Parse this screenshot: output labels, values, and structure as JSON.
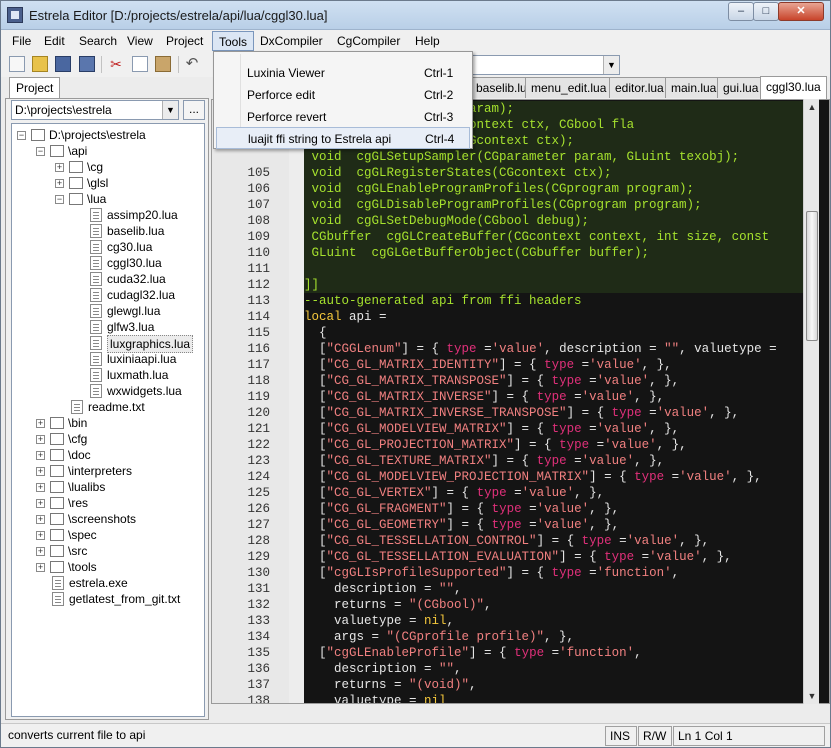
{
  "window": {
    "title": "Estrela Editor [D:/projects/estrela/api/lua/cggl30.lua]",
    "controls": {
      "minimize": "–",
      "maximize": "□",
      "close": "✕"
    }
  },
  "menu": [
    "File",
    "Edit",
    "Search",
    "View",
    "Project",
    "Tools",
    "DxCompiler",
    "CgCompiler",
    "Help"
  ],
  "tools_menu": [
    {
      "label": "Luxinia Viewer",
      "shortcut": "Ctrl-1"
    },
    {
      "label": "Perforce edit",
      "shortcut": "Ctrl-2"
    },
    {
      "label": "Perforce revert",
      "shortcut": "Ctrl-3"
    },
    {
      "label": "luajit ffi string to Estrela api",
      "shortcut": "Ctrl-4"
    }
  ],
  "project": {
    "tab": "Project",
    "path": "D:\\projects\\estrela",
    "browse": "...",
    "tree": [
      {
        "label": "D:\\projects\\estrela",
        "level": 0,
        "type": "folder",
        "expander": "−"
      },
      {
        "label": "\\api",
        "level": 1,
        "type": "folder",
        "expander": "−"
      },
      {
        "label": "\\cg",
        "level": 2,
        "type": "folder",
        "expander": "+"
      },
      {
        "label": "\\glsl",
        "level": 2,
        "type": "folder",
        "expander": "+"
      },
      {
        "label": "\\lua",
        "level": 2,
        "type": "folder",
        "expander": "−"
      },
      {
        "label": "assimp20.lua",
        "level": 3,
        "type": "file"
      },
      {
        "label": "baselib.lua",
        "level": 3,
        "type": "file"
      },
      {
        "label": "cg30.lua",
        "level": 3,
        "type": "file"
      },
      {
        "label": "cggl30.lua",
        "level": 3,
        "type": "file"
      },
      {
        "label": "cuda32.lua",
        "level": 3,
        "type": "file"
      },
      {
        "label": "cudagl32.lua",
        "level": 3,
        "type": "file"
      },
      {
        "label": "glewgl.lua",
        "level": 3,
        "type": "file"
      },
      {
        "label": "glfw3.lua",
        "level": 3,
        "type": "file"
      },
      {
        "label": "luxgraphics.lua",
        "level": 3,
        "type": "file",
        "selected": true
      },
      {
        "label": "luxiniaapi.lua",
        "level": 3,
        "type": "file"
      },
      {
        "label": "luxmath.lua",
        "level": 3,
        "type": "file"
      },
      {
        "label": "wxwidgets.lua",
        "level": 3,
        "type": "file"
      },
      {
        "label": "readme.txt",
        "level": 2,
        "type": "file"
      },
      {
        "label": "\\bin",
        "level": 1,
        "type": "folder",
        "expander": "+"
      },
      {
        "label": "\\cfg",
        "level": 1,
        "type": "folder",
        "expander": "+"
      },
      {
        "label": "\\doc",
        "level": 1,
        "type": "folder",
        "expander": "+"
      },
      {
        "label": "\\interpreters",
        "level": 1,
        "type": "folder",
        "expander": "+"
      },
      {
        "label": "\\lualibs",
        "level": 1,
        "type": "folder",
        "expander": "+"
      },
      {
        "label": "\\res",
        "level": 1,
        "type": "folder",
        "expander": "+"
      },
      {
        "label": "\\screenshots",
        "level": 1,
        "type": "folder",
        "expander": "+"
      },
      {
        "label": "\\spec",
        "level": 1,
        "type": "folder",
        "expander": "+"
      },
      {
        "label": "\\src",
        "level": 1,
        "type": "folder",
        "expander": "+"
      },
      {
        "label": "\\tools",
        "level": 1,
        "type": "folder",
        "expander": "+"
      },
      {
        "label": "estrela.exe",
        "level": 1,
        "type": "file"
      },
      {
        "label": "getlatest_from_git.txt",
        "level": 1,
        "type": "file"
      }
    ]
  },
  "file_tabs": [
    {
      "label": "baselib.lua",
      "active": false
    },
    {
      "label": "menu_edit.lua",
      "active": false
    },
    {
      "label": "editor.lua",
      "active": false
    },
    {
      "label": "main.lua",
      "active": false
    },
    {
      "label": "gui.lua",
      "active": false
    },
    {
      "label": "cggl30.lua",
      "active": true
    }
  ],
  "editor": {
    "lines": [
      {
        "no": "",
        "green": true,
        "segs": [
          [
            "  ",
            "n"
          ],
          [
            "reEnum(CGparameter param);",
            "cm"
          ]
        ]
      },
      {
        "no": "",
        "green": true,
        "segs": [
          [
            "  ",
            "n"
          ],
          [
            "extureParameters(CGcontext ctx, CGbool fla",
            "cm"
          ]
        ]
      },
      {
        "no": "",
        "green": true,
        "segs": [
          [
            "  ",
            "n"
          ],
          [
            "eTextureParameters(CGcontext ctx);",
            "cm"
          ]
        ]
      },
      {
        "no": "",
        "green": true,
        "segs": [
          [
            " void  cgGLSetupSampler(CGparameter param, GLuint texobj);",
            "cm"
          ]
        ]
      },
      {
        "no": "105",
        "green": true,
        "segs": [
          [
            " void  cgGLRegisterStates(CGcontext ctx);",
            "cm"
          ]
        ]
      },
      {
        "no": "106",
        "green": true,
        "segs": [
          [
            " void  cgGLEnableProgramProfiles(CGprogram program);",
            "cm"
          ]
        ]
      },
      {
        "no": "107",
        "green": true,
        "segs": [
          [
            " void  cgGLDisableProgramProfiles(CGprogram program);",
            "cm"
          ]
        ]
      },
      {
        "no": "108",
        "green": true,
        "segs": [
          [
            " void  cgGLSetDebugMode(CGbool debug);",
            "cm"
          ]
        ]
      },
      {
        "no": "109",
        "green": true,
        "segs": [
          [
            " CGbuffer  cgGLCreateBuffer(CGcontext context, int size, const",
            "cm"
          ]
        ]
      },
      {
        "no": "110",
        "green": true,
        "segs": [
          [
            " GLuint  cgGLGetBufferObject(CGbuffer buffer);",
            "cm"
          ]
        ]
      },
      {
        "no": "111",
        "green": true,
        "segs": [
          [
            "",
            "cm"
          ]
        ]
      },
      {
        "no": "112",
        "green": true,
        "segs": [
          [
            "]]",
            "cm"
          ]
        ]
      },
      {
        "no": "113",
        "green": false,
        "segs": [
          [
            "--auto-generated api from ffi headers",
            "cm"
          ]
        ]
      },
      {
        "no": "114",
        "green": false,
        "segs": [
          [
            "local",
            "kw"
          ],
          [
            " api =",
            "n"
          ]
        ]
      },
      {
        "no": "115",
        "green": false,
        "segs": [
          [
            "  {",
            "n"
          ]
        ]
      },
      {
        "no": "116",
        "green": false,
        "segs": [
          [
            "  [",
            "n"
          ],
          [
            "\"CGGLenum\"",
            "str"
          ],
          [
            "] = { ",
            "n"
          ],
          [
            "type",
            "ty"
          ],
          [
            " =",
            "n"
          ],
          [
            "'value'",
            "str"
          ],
          [
            ", description = ",
            "n"
          ],
          [
            "\"\"",
            "str"
          ],
          [
            ", valuetype =",
            "n"
          ]
        ]
      },
      {
        "no": "117",
        "green": false,
        "segs": [
          [
            "  [",
            "n"
          ],
          [
            "\"CG_GL_MATRIX_IDENTITY\"",
            "str"
          ],
          [
            "] = { ",
            "n"
          ],
          [
            "type",
            "ty"
          ],
          [
            " =",
            "n"
          ],
          [
            "'value'",
            "str"
          ],
          [
            ", },",
            "n"
          ]
        ]
      },
      {
        "no": "118",
        "green": false,
        "segs": [
          [
            "  [",
            "n"
          ],
          [
            "\"CG_GL_MATRIX_TRANSPOSE\"",
            "str"
          ],
          [
            "] = { ",
            "n"
          ],
          [
            "type",
            "ty"
          ],
          [
            " =",
            "n"
          ],
          [
            "'value'",
            "str"
          ],
          [
            ", },",
            "n"
          ]
        ]
      },
      {
        "no": "119",
        "green": false,
        "segs": [
          [
            "  [",
            "n"
          ],
          [
            "\"CG_GL_MATRIX_INVERSE\"",
            "str"
          ],
          [
            "] = { ",
            "n"
          ],
          [
            "type",
            "ty"
          ],
          [
            " =",
            "n"
          ],
          [
            "'value'",
            "str"
          ],
          [
            ", },",
            "n"
          ]
        ]
      },
      {
        "no": "120",
        "green": false,
        "segs": [
          [
            "  [",
            "n"
          ],
          [
            "\"CG_GL_MATRIX_INVERSE_TRANSPOSE\"",
            "str"
          ],
          [
            "] = { ",
            "n"
          ],
          [
            "type",
            "ty"
          ],
          [
            " =",
            "n"
          ],
          [
            "'value'",
            "str"
          ],
          [
            ", },",
            "n"
          ]
        ]
      },
      {
        "no": "121",
        "green": false,
        "segs": [
          [
            "  [",
            "n"
          ],
          [
            "\"CG_GL_MODELVIEW_MATRIX\"",
            "str"
          ],
          [
            "] = { ",
            "n"
          ],
          [
            "type",
            "ty"
          ],
          [
            " =",
            "n"
          ],
          [
            "'value'",
            "str"
          ],
          [
            ", },",
            "n"
          ]
        ]
      },
      {
        "no": "122",
        "green": false,
        "segs": [
          [
            "  [",
            "n"
          ],
          [
            "\"CG_GL_PROJECTION_MATRIX\"",
            "str"
          ],
          [
            "] = { ",
            "n"
          ],
          [
            "type",
            "ty"
          ],
          [
            " =",
            "n"
          ],
          [
            "'value'",
            "str"
          ],
          [
            ", },",
            "n"
          ]
        ]
      },
      {
        "no": "123",
        "green": false,
        "segs": [
          [
            "  [",
            "n"
          ],
          [
            "\"CG_GL_TEXTURE_MATRIX\"",
            "str"
          ],
          [
            "] = { ",
            "n"
          ],
          [
            "type",
            "ty"
          ],
          [
            " =",
            "n"
          ],
          [
            "'value'",
            "str"
          ],
          [
            ", },",
            "n"
          ]
        ]
      },
      {
        "no": "124",
        "green": false,
        "segs": [
          [
            "  [",
            "n"
          ],
          [
            "\"CG_GL_MODELVIEW_PROJECTION_MATRIX\"",
            "str"
          ],
          [
            "] = { ",
            "n"
          ],
          [
            "type",
            "ty"
          ],
          [
            " =",
            "n"
          ],
          [
            "'value'",
            "str"
          ],
          [
            ", },",
            "n"
          ]
        ]
      },
      {
        "no": "125",
        "green": false,
        "segs": [
          [
            "  [",
            "n"
          ],
          [
            "\"CG_GL_VERTEX\"",
            "str"
          ],
          [
            "] = { ",
            "n"
          ],
          [
            "type",
            "ty"
          ],
          [
            " =",
            "n"
          ],
          [
            "'value'",
            "str"
          ],
          [
            ", },",
            "n"
          ]
        ]
      },
      {
        "no": "126",
        "green": false,
        "segs": [
          [
            "  [",
            "n"
          ],
          [
            "\"CG_GL_FRAGMENT\"",
            "str"
          ],
          [
            "] = { ",
            "n"
          ],
          [
            "type",
            "ty"
          ],
          [
            " =",
            "n"
          ],
          [
            "'value'",
            "str"
          ],
          [
            ", },",
            "n"
          ]
        ]
      },
      {
        "no": "127",
        "green": false,
        "segs": [
          [
            "  [",
            "n"
          ],
          [
            "\"CG_GL_GEOMETRY\"",
            "str"
          ],
          [
            "] = { ",
            "n"
          ],
          [
            "type",
            "ty"
          ],
          [
            " =",
            "n"
          ],
          [
            "'value'",
            "str"
          ],
          [
            ", },",
            "n"
          ]
        ]
      },
      {
        "no": "128",
        "green": false,
        "segs": [
          [
            "  [",
            "n"
          ],
          [
            "\"CG_GL_TESSELLATION_CONTROL\"",
            "str"
          ],
          [
            "] = { ",
            "n"
          ],
          [
            "type",
            "ty"
          ],
          [
            " =",
            "n"
          ],
          [
            "'value'",
            "str"
          ],
          [
            ", },",
            "n"
          ]
        ]
      },
      {
        "no": "129",
        "green": false,
        "segs": [
          [
            "  [",
            "n"
          ],
          [
            "\"CG_GL_TESSELLATION_EVALUATION\"",
            "str"
          ],
          [
            "] = { ",
            "n"
          ],
          [
            "type",
            "ty"
          ],
          [
            " =",
            "n"
          ],
          [
            "'value'",
            "str"
          ],
          [
            ", },",
            "n"
          ]
        ]
      },
      {
        "no": "130",
        "green": false,
        "segs": [
          [
            "  [",
            "n"
          ],
          [
            "\"cgGLIsProfileSupported\"",
            "str"
          ],
          [
            "] = { ",
            "n"
          ],
          [
            "type",
            "ty"
          ],
          [
            " =",
            "n"
          ],
          [
            "'function'",
            "str"
          ],
          [
            ",",
            "n"
          ]
        ]
      },
      {
        "no": "131",
        "green": false,
        "segs": [
          [
            "    description = ",
            "n"
          ],
          [
            "\"\"",
            "str"
          ],
          [
            ",",
            "n"
          ]
        ]
      },
      {
        "no": "132",
        "green": false,
        "segs": [
          [
            "    returns = ",
            "n"
          ],
          [
            "\"(CGbool)\"",
            "str"
          ],
          [
            ",",
            "n"
          ]
        ]
      },
      {
        "no": "133",
        "green": false,
        "segs": [
          [
            "    valuetype = ",
            "n"
          ],
          [
            "nil",
            "kw"
          ],
          [
            ",",
            "n"
          ]
        ]
      },
      {
        "no": "134",
        "green": false,
        "segs": [
          [
            "    args = ",
            "n"
          ],
          [
            "\"(CGprofile profile)\"",
            "str"
          ],
          [
            ", },",
            "n"
          ]
        ]
      },
      {
        "no": "135",
        "green": false,
        "segs": [
          [
            "  [",
            "n"
          ],
          [
            "\"cgGLEnableProfile\"",
            "str"
          ],
          [
            "] = { ",
            "n"
          ],
          [
            "type",
            "ty"
          ],
          [
            " =",
            "n"
          ],
          [
            "'function'",
            "str"
          ],
          [
            ",",
            "n"
          ]
        ]
      },
      {
        "no": "136",
        "green": false,
        "segs": [
          [
            "    description = ",
            "n"
          ],
          [
            "\"\"",
            "str"
          ],
          [
            ",",
            "n"
          ]
        ]
      },
      {
        "no": "137",
        "green": false,
        "segs": [
          [
            "    returns = ",
            "n"
          ],
          [
            "\"(void)\"",
            "str"
          ],
          [
            ",",
            "n"
          ]
        ]
      },
      {
        "no": "138",
        "green": false,
        "segs": [
          [
            "    valuetype = ",
            "n"
          ],
          [
            "nil",
            "kw"
          ]
        ]
      }
    ]
  },
  "status": {
    "message": "converts current file to api",
    "ins": "INS",
    "rw": "R/W",
    "position": "Ln 1 Col 1"
  },
  "colors": {
    "editor_bg": "#141414",
    "comment_block": "#b7e04a",
    "string": "#f08080",
    "type_keyword": "#e0307a",
    "keyword": "#f5c83c"
  }
}
